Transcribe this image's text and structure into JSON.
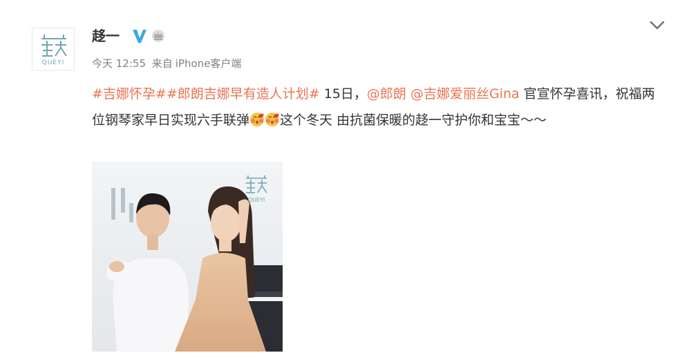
{
  "header": {
    "nickname": "趍一",
    "verified_icon": "verified-v-icon",
    "member_icon": "crown-icon",
    "time": "今天 12:55",
    "source_prefix": "来自",
    "source": "iPhone客户端",
    "more_icon": "chevron-down-icon"
  },
  "avatar": {
    "brand_text": "QUEYI"
  },
  "post": {
    "hashtag1": "#吉娜怀孕#",
    "hashtag2": "#郎朗吉娜早有造人计划#",
    "text1": " 15日，",
    "mention1": "@郎朗",
    "mention2": "@吉娜爱丽丝Gina",
    "text2": " 官宣怀孕喜讯，祝福两位钢琴家早日实现六手联弹",
    "text3": "这个冬天 由抗菌保暖的趍一守护你和宝宝～～",
    "emoji_icon": "kiss-emoji-icon"
  },
  "photo": {
    "logo_text": "QUEYI"
  },
  "colors": {
    "link": "#eb7350",
    "meta": "#808080",
    "verified": "#3fa9e0",
    "brand": "#6fa7b0"
  }
}
